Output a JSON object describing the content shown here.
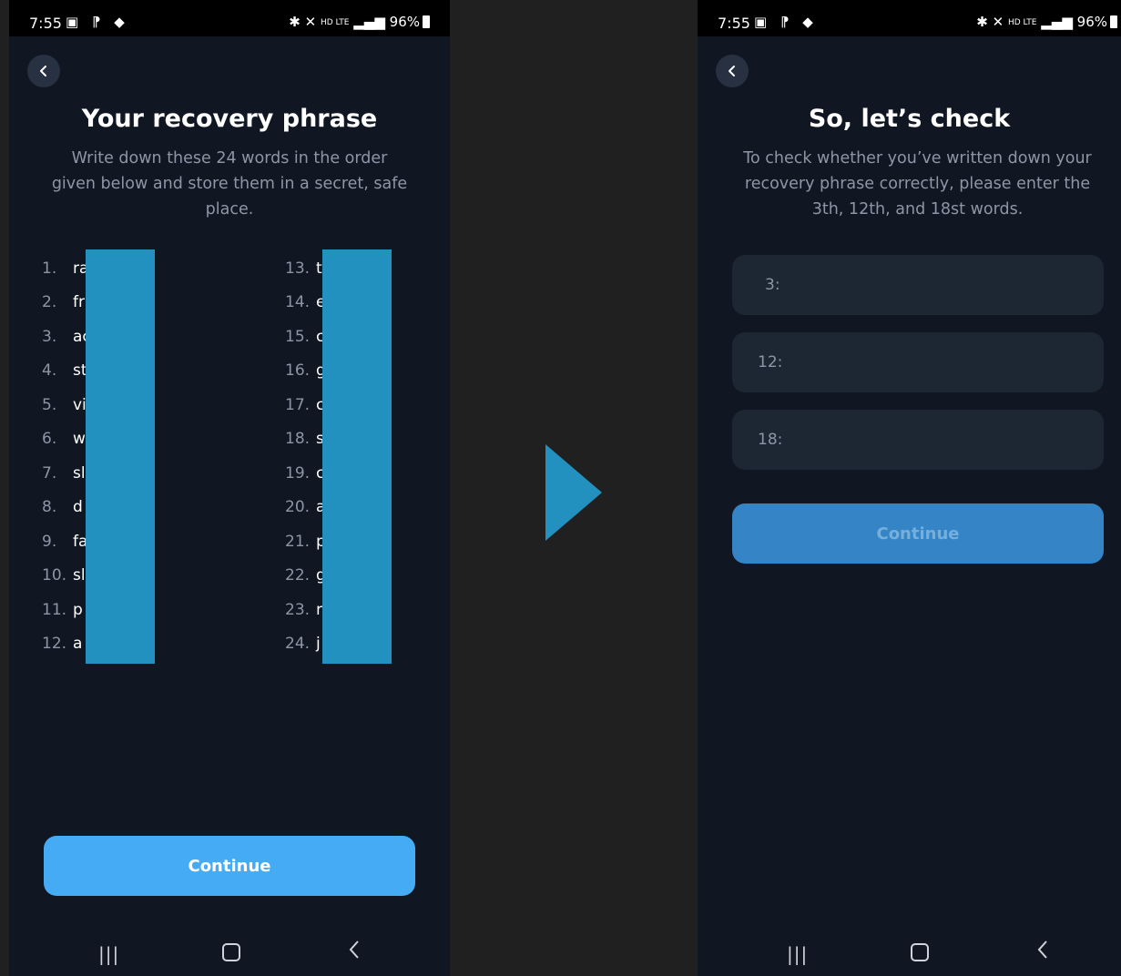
{
  "left": {
    "status_time": "7:55",
    "status_battery": "96%",
    "title": "Your recovery phrase",
    "subtitle": "Write down these 24 words in the order given below and store them in a secret, safe place.",
    "words_col1": [
      {
        "n": "1.",
        "w": "ra"
      },
      {
        "n": "2.",
        "w": "fr"
      },
      {
        "n": "3.",
        "w": "ac"
      },
      {
        "n": "4.",
        "w": "st"
      },
      {
        "n": "5.",
        "w": "vi"
      },
      {
        "n": "6.",
        "w": "w"
      },
      {
        "n": "7.",
        "w": "sl"
      },
      {
        "n": "8.",
        "w": "d"
      },
      {
        "n": "9.",
        "w": "fa"
      },
      {
        "n": "10.",
        "w": "sl"
      },
      {
        "n": "11.",
        "w": "p"
      },
      {
        "n": "12.",
        "w": "a"
      }
    ],
    "words_col2": [
      {
        "n": "13.",
        "w": "t"
      },
      {
        "n": "14.",
        "w": "e"
      },
      {
        "n": "15.",
        "w": "c"
      },
      {
        "n": "16.",
        "w": "g"
      },
      {
        "n": "17.",
        "w": "c"
      },
      {
        "n": "18.",
        "w": "s"
      },
      {
        "n": "19.",
        "w": "c"
      },
      {
        "n": "20.",
        "w": "a"
      },
      {
        "n": "21.",
        "w": "p"
      },
      {
        "n": "22.",
        "w": "g"
      },
      {
        "n": "23.",
        "w": "r"
      },
      {
        "n": "24.",
        "w": "j"
      }
    ],
    "continue_label": "Continue"
  },
  "right": {
    "status_time": "7:55",
    "status_battery": "96%",
    "title": "So, let’s check",
    "subtitle": "To check whether you’ve written down your recovery phrase correctly, please enter the 3th, 12th, and  18st words.",
    "fields": [
      {
        "label": "3:"
      },
      {
        "label": "12:"
      },
      {
        "label": "18:"
      }
    ],
    "continue_label": "Continue"
  },
  "colors": {
    "screen_bg": "#111722",
    "outer_bg": "#202020",
    "primary_button": "#45abf4",
    "disabled_button": "#3585c6",
    "redaction": "#2291c0",
    "arrow": "#2291c0"
  },
  "icons": [
    "back-chevron-icon",
    "recents-icon",
    "home-icon",
    "nav-back-icon",
    "bluetooth-icon",
    "mute-icon",
    "signal-icon",
    "battery-icon",
    "arrow-right-icon"
  ]
}
